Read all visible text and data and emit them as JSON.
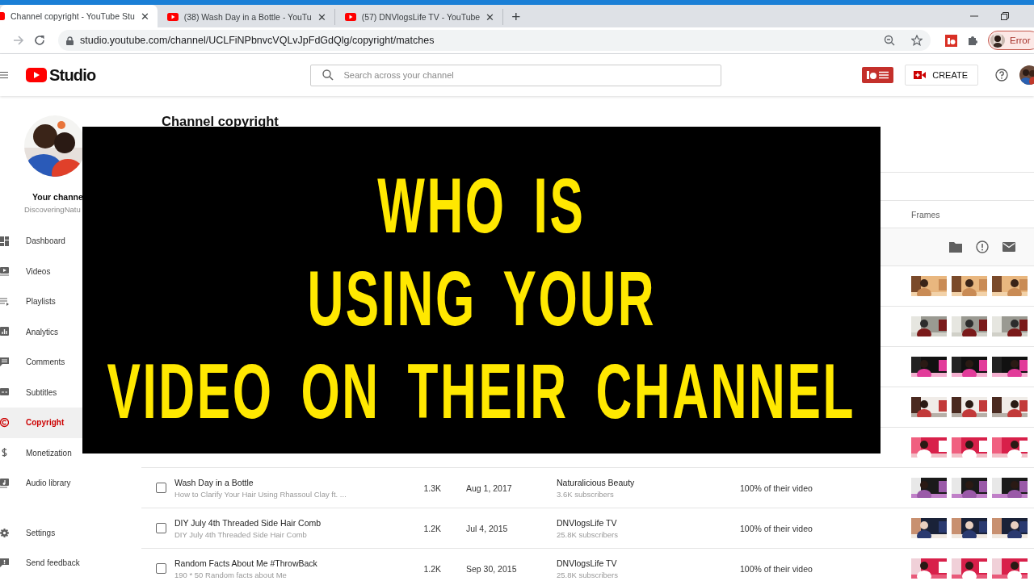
{
  "browser": {
    "tabs": [
      {
        "title": "Channel copyright - YouTube Stu",
        "close": "✕",
        "selected": true
      },
      {
        "title": "(38) Wash Day in a Bottle - YouTu",
        "close": "✕",
        "selected": false
      },
      {
        "title": "(57) DNVlogsLife TV - YouTube",
        "close": "✕",
        "selected": false
      }
    ],
    "new_tab": "+",
    "url": "studio.youtube.com/channel/UCLFiNPbnvcVQLvJpFdGdQlg/copyright/matches",
    "profile_status": "Error"
  },
  "header": {
    "logo": "Studio",
    "search_placeholder": "Search across your channel",
    "create": "CREATE"
  },
  "sidebar": {
    "channel_heading": "Your channe",
    "channel_name": "DiscoveringNatu",
    "items": [
      {
        "label": "Dashboard",
        "selected": false
      },
      {
        "label": "Videos",
        "selected": false
      },
      {
        "label": "Playlists",
        "selected": false
      },
      {
        "label": "Analytics",
        "selected": false
      },
      {
        "label": "Comments",
        "selected": false
      },
      {
        "label": "Subtitles",
        "selected": false
      },
      {
        "label": "Copyright",
        "selected": true
      },
      {
        "label": "Monetization",
        "selected": false
      },
      {
        "label": "Audio library",
        "selected": false
      }
    ],
    "footer_items": [
      {
        "label": "Settings"
      },
      {
        "label": "Send feedback"
      }
    ]
  },
  "page": {
    "title": "Channel copyright",
    "frames_heading": "Frames"
  },
  "rows": [
    {
      "frames": [
        {
          "kind": "picture"
        },
        {
          "kind": "picture"
        },
        {
          "kind": "picture"
        }
      ]
    },
    {
      "frames": [
        {
          "kind": "picture"
        },
        {
          "kind": "picture"
        },
        {
          "kind": "picture"
        }
      ]
    },
    {
      "frames": [
        {
          "kind": "picture"
        },
        {
          "kind": "picture"
        },
        {
          "kind": "picture"
        }
      ]
    },
    {
      "frames": [
        {
          "kind": "picture"
        },
        {
          "kind": "picture"
        },
        {
          "kind": "picture"
        }
      ]
    },
    {
      "frames": [
        {
          "kind": "picture"
        },
        {
          "kind": "picture"
        },
        {
          "kind": "picture"
        }
      ]
    },
    {
      "checked": false,
      "title": "Wash Day in a Bottle",
      "subtitle": "How to Clarify Your Hair Using Rhassoul Clay ft. ...",
      "views": "1.3K",
      "date": "Aug 1, 2017",
      "channel": "Naturalicious Beauty",
      "subscribers": "3.6K subscribers",
      "match": "100% of their video",
      "frames": [
        {
          "kind": "picture"
        },
        {
          "kind": "picture"
        },
        {
          "kind": "picture"
        }
      ]
    },
    {
      "checked": false,
      "title": "DIY July 4th Threaded Side Hair Comb",
      "subtitle": "DIY July 4th Threaded Side Hair Comb",
      "views": "1.2K",
      "date": "Jul 4, 2015",
      "channel": "DNVlogsLife TV",
      "subscribers": "25.8K subscribers",
      "match": "100% of their video",
      "frames": [
        {
          "kind": "picture"
        },
        {
          "kind": "picture"
        },
        {
          "kind": "picture"
        }
      ]
    },
    {
      "checked": false,
      "title": "Random Facts About Me #ThrowBack",
      "subtitle": "190 * 50 Random facts about Me",
      "views": "1.2K",
      "date": "Sep 30, 2015",
      "channel": "DNVlogsLife TV",
      "subscribers": "25.8K subscribers",
      "match": "100% of their video",
      "frames": [
        {
          "kind": "picture"
        },
        {
          "kind": "picture"
        },
        {
          "kind": "picture"
        }
      ]
    }
  ],
  "overlay": {
    "lines": [
      "WHO IS",
      "USING YOUR",
      "VIDEO ON THEIR CHANNEL"
    ]
  }
}
